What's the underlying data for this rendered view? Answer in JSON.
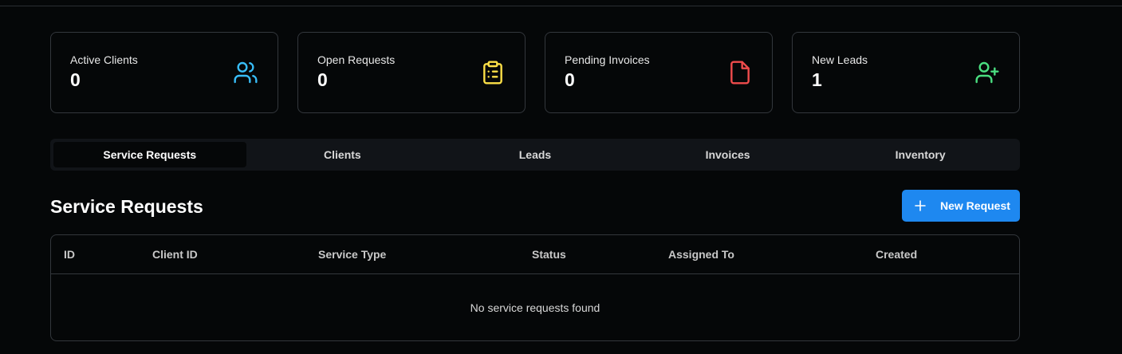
{
  "stats": [
    {
      "label": "Active Clients",
      "value": "0",
      "icon": "users-icon",
      "color": "#38bdf8"
    },
    {
      "label": "Open Requests",
      "value": "0",
      "icon": "clipboard-list-icon",
      "color": "#fde047"
    },
    {
      "label": "Pending Invoices",
      "value": "0",
      "icon": "file-icon",
      "color": "#f04c4c"
    },
    {
      "label": "New Leads",
      "value": "1",
      "icon": "user-plus-icon",
      "color": "#4ade80"
    }
  ],
  "tabs": [
    {
      "label": "Service Requests",
      "active": true
    },
    {
      "label": "Clients",
      "active": false
    },
    {
      "label": "Leads",
      "active": false
    },
    {
      "label": "Invoices",
      "active": false
    },
    {
      "label": "Inventory",
      "active": false
    }
  ],
  "section": {
    "title": "Service Requests",
    "new_button_label": "New Request",
    "accent": "#1e88f0"
  },
  "table": {
    "columns": [
      "ID",
      "Client ID",
      "Service Type",
      "Status",
      "Assigned To",
      "Created"
    ],
    "empty_message": "No service requests found"
  }
}
